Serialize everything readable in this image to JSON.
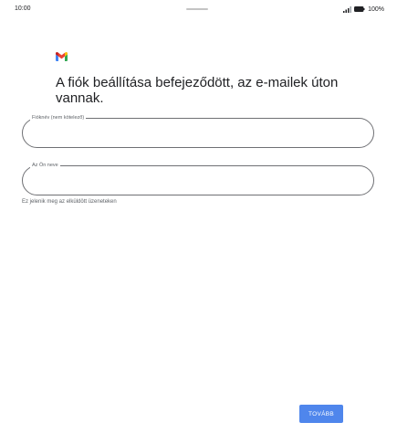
{
  "status_bar": {
    "time": "10:00",
    "battery_text": "100%"
  },
  "app": {
    "logo_icon": "gmail-logo-icon",
    "brand_colors": {
      "red": "#ea4335",
      "blue": "#4285f4",
      "green": "#34a853",
      "yellow": "#fbbc04"
    }
  },
  "main": {
    "title": "A fiók beállítása befejeződött, az e-mailek úton vannak.",
    "account_name_field": {
      "label": "Fióknév (nem kötelező)",
      "value": ""
    },
    "your_name_field": {
      "label": "Az Ön neve",
      "value": ""
    },
    "helper_text": "Ez jelenik meg az elküldött üzeneteken"
  },
  "footer": {
    "next_label": "TOVÁBB",
    "accent_color": "#4f86ec"
  }
}
